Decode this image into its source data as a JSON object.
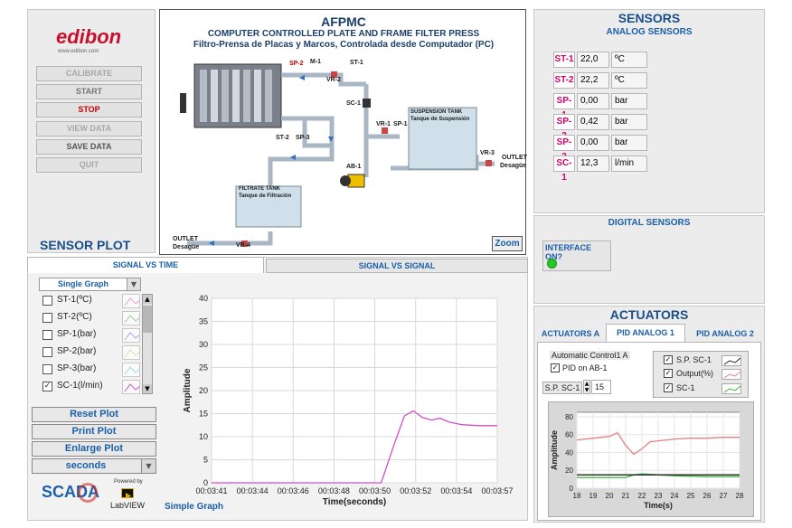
{
  "brand": {
    "logo": "edibon",
    "url": "www.edibon.com"
  },
  "menu": {
    "calibrate": "CALIBRATE",
    "start": "START",
    "stop": "STOP",
    "view_data": "VIEW DATA",
    "save_data": "SAVE DATA",
    "quit": "QUIT"
  },
  "diagram": {
    "title": "AFPMC",
    "subtitle_en": "COMPUTER CONTROLLED PLATE AND FRAME FILTER PRESS",
    "subtitle_es": "Filtro-Prensa de Placas y Marcos, Controlada desde Computador (PC)",
    "labels": {
      "sp2_top": "SP-2",
      "m1": "M-1",
      "vr2": "VR-2",
      "st1": "ST-1",
      "sc1": "SC-1",
      "vr1": "VR-1",
      "sp1": "SP-1",
      "st2": "ST-2",
      "sp3": "SP-3",
      "ab1": "AB-1",
      "vr3": "VR-3",
      "vr4": "VR-4",
      "outlet": "OUTLET",
      "desague": "Desagüe",
      "susp_tank": "SUSPENSION TANK",
      "susp_tank_es": "Tanque de Suspensión",
      "filt_tank": "FILTRATE TANK",
      "filt_tank_es": "Tanque de Filtración"
    },
    "zoom": "Zoom"
  },
  "sensors": {
    "title": "SENSORS",
    "analog_title": "ANALOG SENSORS",
    "analog": [
      {
        "tag": "ST-1",
        "value": "22,0",
        "unit": "ºC"
      },
      {
        "tag": "ST-2",
        "value": "22,2",
        "unit": "ºC"
      },
      {
        "tag": "SP-1",
        "value": "0,00",
        "unit": "bar"
      },
      {
        "tag": "SP-2",
        "value": "0,42",
        "unit": "bar"
      },
      {
        "tag": "SP-3",
        "value": "0,00",
        "unit": "bar"
      },
      {
        "tag": "SC-1",
        "value": "12,3",
        "unit": "l/min"
      }
    ],
    "digital_title": "DIGITAL SENSORS",
    "interface_label": "INTERFACE ON?",
    "interface_color": "#22cc22"
  },
  "sensor_plot": {
    "title": "SENSOR PLOT",
    "tab1": "SIGNAL VS TIME",
    "tab2": "SIGNAL VS SIGNAL",
    "mode": "Single Graph",
    "channels": [
      {
        "label": "ST-1(ºC)",
        "checked": false
      },
      {
        "label": "ST-2(ºC)",
        "checked": false
      },
      {
        "label": "SP-1(bar)",
        "checked": false
      },
      {
        "label": "SP-2(bar)",
        "checked": false
      },
      {
        "label": "SP-3(bar)",
        "checked": false
      },
      {
        "label": "SC-1(l/min)",
        "checked": true
      }
    ],
    "check_mark": "✓",
    "reset": "Reset Plot",
    "print": "Print Plot",
    "enlarge": "Enlarge Plot",
    "units": "seconds",
    "graph_name": "Simple Graph"
  },
  "footer": {
    "scada": "SCADA",
    "powered": "Powered by",
    "labview": "LabVIEW"
  },
  "actuators": {
    "title": "ACTUATORS",
    "tabs": [
      "ACTUATORS A",
      "PID ANALOG 1",
      "PID ANALOG 2"
    ],
    "auto_label": "Automatic Control1 A",
    "pid_label": "PID on AB-1",
    "sp_label": "S.P. SC-1",
    "sp_value": "15",
    "legend": [
      {
        "label": "S.P. SC-1",
        "color": "#222222"
      },
      {
        "label": "Output(%)",
        "color": "#e08080"
      },
      {
        "label": "SC-1",
        "color": "#3cb43c"
      }
    ]
  },
  "chart_data": [
    {
      "type": "line",
      "title": "",
      "xlabel": "Time(seconds)",
      "ylabel": "Amplitude",
      "x_ticks": [
        "00:03:41",
        "00:03:44",
        "00:03:46",
        "00:03:48",
        "00:03:50",
        "00:03:52",
        "00:03:54",
        "00:03:57"
      ],
      "y_ticks": [
        0,
        5,
        10,
        15,
        20,
        25,
        30,
        35,
        40
      ],
      "ylim": [
        0,
        40
      ],
      "xlim": [
        0,
        16
      ],
      "grid": true,
      "series": [
        {
          "name": "SC-1(l/min)",
          "color": "#d050c8",
          "x": [
            0,
            9.5,
            10.2,
            10.8,
            11.3,
            11.8,
            12.3,
            12.8,
            13.3,
            14,
            15,
            16
          ],
          "y": [
            0,
            0,
            8,
            14.5,
            15.6,
            14.2,
            13.6,
            14.0,
            13.2,
            12.6,
            12.4,
            12.4
          ]
        }
      ]
    },
    {
      "type": "line",
      "title": "",
      "xlabel": "Time(s)",
      "ylabel": "Amplitude",
      "x_ticks": [
        18,
        19,
        20,
        21,
        22,
        23,
        24,
        25,
        26,
        27,
        28
      ],
      "y_ticks": [
        0,
        20,
        40,
        60,
        80
      ],
      "ylim": [
        0,
        85
      ],
      "xlim": [
        18,
        28
      ],
      "grid": true,
      "series": [
        {
          "name": "Output(%)",
          "color": "#e08080",
          "x": [
            18,
            19,
            20,
            20.5,
            21,
            21.5,
            22,
            22.5,
            23,
            24,
            25,
            26,
            27,
            28
          ],
          "y": [
            54,
            56,
            58,
            62,
            48,
            38,
            44,
            52,
            53,
            55,
            56,
            56,
            57,
            57
          ]
        },
        {
          "name": "SC-1",
          "color": "#3cb43c",
          "x": [
            18,
            20,
            21,
            21.5,
            22,
            23,
            24,
            25,
            26,
            27,
            28
          ],
          "y": [
            12,
            12,
            12,
            15,
            16,
            15,
            14,
            13.5,
            13,
            13,
            13
          ]
        },
        {
          "name": "S.P. SC-1",
          "color": "#222222",
          "x": [
            18,
            28
          ],
          "y": [
            15,
            15
          ]
        }
      ]
    }
  ]
}
